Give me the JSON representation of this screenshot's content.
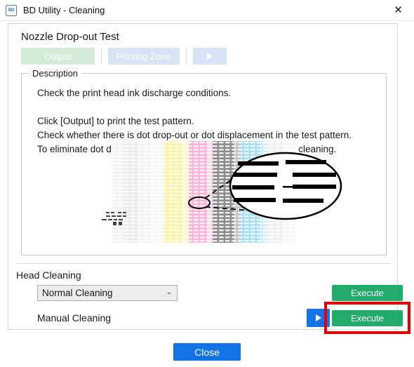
{
  "window": {
    "icon_label": "BD",
    "icon_name": "bd-app-icon",
    "title": "BD Utility - Cleaning",
    "close_glyph": "✕"
  },
  "panel": {
    "section_title": "Nozzle Drop-out Test",
    "toolbar": {
      "output_label": "Output",
      "printing_zone_label": "Printing Zone",
      "play_icon": "play-icon"
    },
    "description": {
      "legend": "Description",
      "body": "Check the print head ink discharge conditions.\n\nClick [Output] to print the test pattern.\nCheck whether there is dot drop-out or dot displacement in the test pattern.\nTo eliminate dot drop-out and dot displacement, perform head cleaning."
    },
    "pattern": {
      "alt": "nozzle-check-test-pattern",
      "stripe_colors": [
        "#f2f2f2",
        "#eaeaea",
        "#fff2a8",
        "#ffb6d9",
        "#9a9a9a",
        "#a9e2f7",
        "#efefef"
      ],
      "magnifier": "magnified-dropout-detail"
    }
  },
  "head_cleaning": {
    "title": "Head Cleaning",
    "normal_select_value": "Normal Cleaning",
    "normal_select_caret": "⌄",
    "normal_execute_label": "Execute",
    "manual_label": "Manual Cleaning",
    "manual_play_icon": "play-icon",
    "manual_execute_label": "Execute",
    "highlight_color": "#e00000"
  },
  "footer": {
    "close_label": "Close"
  },
  "colors": {
    "execute_green": "#22ab6b",
    "primary_blue": "#1273e6",
    "output_green_disabled": "#d4ecd7",
    "zone_blue_disabled": "#d6e4f5"
  }
}
